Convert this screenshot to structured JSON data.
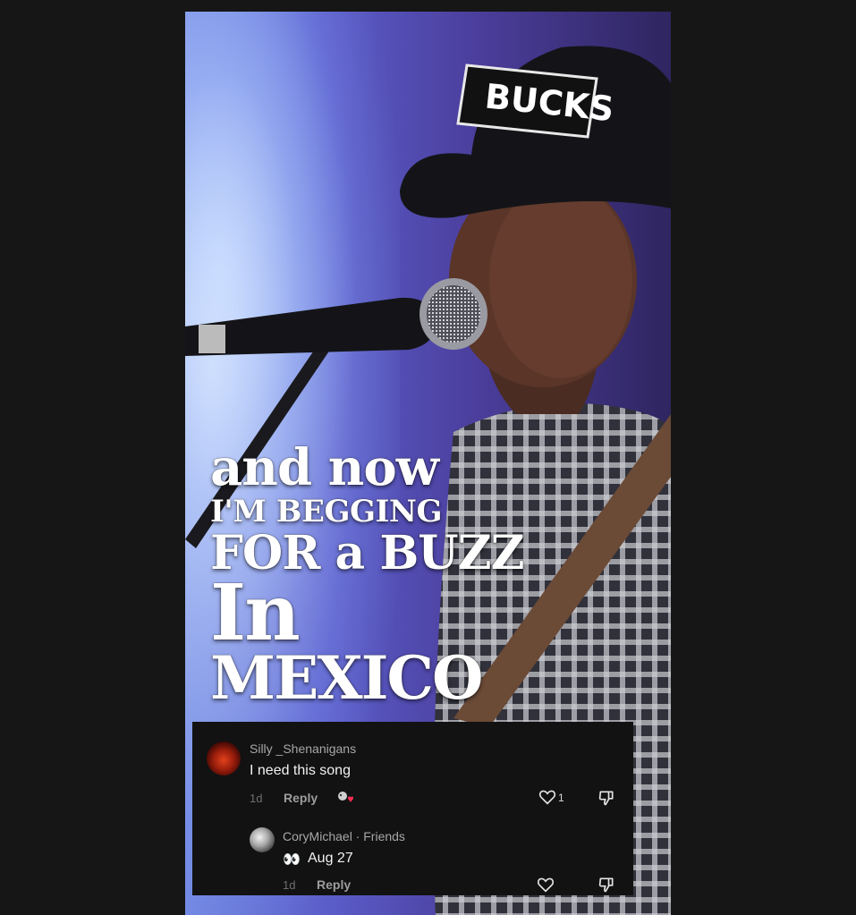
{
  "lyrics": {
    "line1": "and now",
    "line2": "I'm begging",
    "line3": "FOR a BUZZ",
    "line4": "In",
    "line5": "Mexico"
  },
  "hat_text": "BUCKS",
  "comments": [
    {
      "username": "Silly _Shenanigans",
      "text": "I need this song",
      "time": "1d",
      "reply_label": "Reply",
      "like_count": "1"
    },
    {
      "username": "CoryMichael · Friends",
      "emoji": "👀",
      "text": "Aug 27",
      "time": "1d",
      "reply_label": "Reply",
      "like_count": ""
    }
  ],
  "icons": [
    "heart-icon",
    "dislike-icon",
    "sticker-icon"
  ],
  "colors": {
    "panel": "#121212",
    "accent_red": "#ff2d55"
  }
}
